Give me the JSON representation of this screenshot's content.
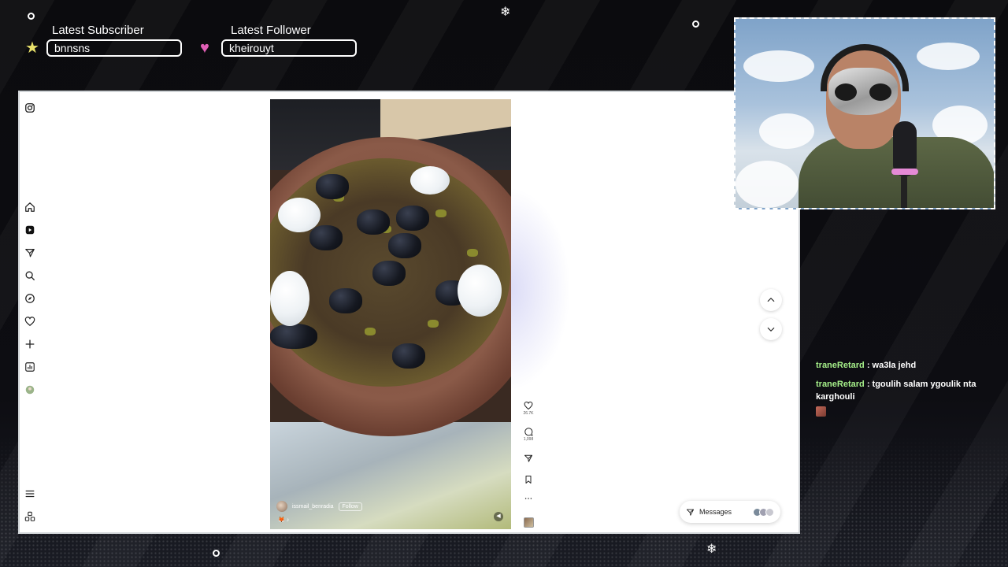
{
  "alerts": {
    "subscriber": {
      "title": "Latest Subscriber",
      "value": "bnnsns"
    },
    "follower": {
      "title": "Latest Follower",
      "value": "kheirouyt"
    }
  },
  "instagram": {
    "sidebar_icons": [
      "instagram-logo-icon",
      "home-icon",
      "reels-icon",
      "messages-icon",
      "search-icon",
      "explore-icon",
      "notifications-icon",
      "create-icon",
      "dashboard-icon",
      "profile-avatar-icon",
      "more-menu-icon",
      "meta-icon"
    ],
    "reel": {
      "username": "issmail_benradia",
      "follow_label": "Follow",
      "audio": "🦊 ♪"
    },
    "actions": {
      "likes": "26.7K",
      "comments": "1,098"
    },
    "messages_label": "Messages"
  },
  "chat": [
    {
      "user": "traneRetard",
      "message": ": wa3la jehd"
    },
    {
      "user": "traneRetard",
      "message": ": tgoulih salam ygoulik nta karghouli"
    }
  ],
  "colors": {
    "chat_user": "#a6f08a",
    "overlay_bg": "#0a0a0c",
    "heart_pink": "#e05fb5",
    "star_yellow": "#e8e06a"
  }
}
